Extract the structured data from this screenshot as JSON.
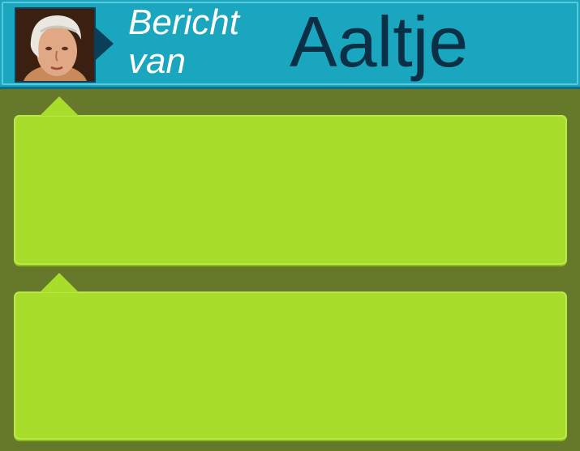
{
  "header": {
    "subtitle": "Bericht van",
    "sender_name": "Aaltje",
    "avatar_icon": "woman-portrait-icon"
  },
  "messages": [
    {
      "text": ""
    },
    {
      "text": ""
    }
  ],
  "colors": {
    "background": "#66782a",
    "header": "#1aa6bf",
    "bubble": "#a9dd2c",
    "name_text": "#0b2f44"
  }
}
